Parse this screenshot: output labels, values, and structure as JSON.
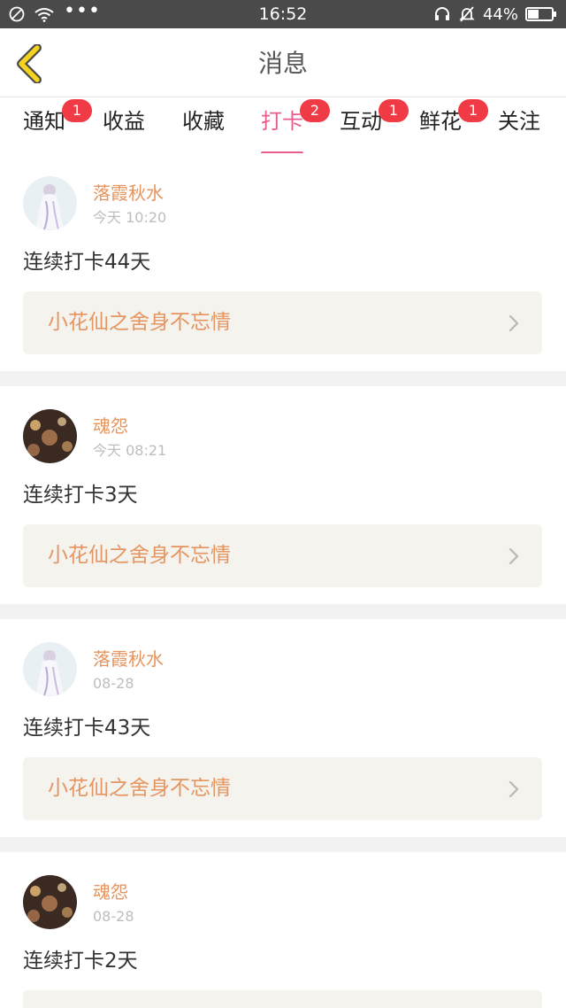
{
  "status_bar": {
    "time": "16:52",
    "battery": "44%",
    "icons": [
      "no-sim-icon",
      "wifi-icon",
      "more-dots-icon",
      "headset-icon",
      "mute-icon",
      "battery-icon"
    ]
  },
  "header": {
    "title": "消息",
    "back_icon": "back-chevron-icon",
    "accent_color": "#f5d21f"
  },
  "tabs": [
    {
      "label": "通知",
      "badge": "1"
    },
    {
      "label": "收益",
      "badge": ""
    },
    {
      "label": "收藏",
      "badge": ""
    },
    {
      "label": "打卡",
      "badge": "2",
      "active": true
    },
    {
      "label": "互动",
      "badge": "1"
    },
    {
      "label": "鲜花",
      "badge": "1"
    },
    {
      "label": "关注",
      "badge": ""
    }
  ],
  "colors": {
    "active_tab": "#e85d8f",
    "badge": "#f03a45",
    "username": "#e59560",
    "link_bg": "#f4f3ee"
  },
  "messages": [
    {
      "user": "落霞秋水",
      "time": "今天 10:20",
      "text": "连续打卡44天",
      "link": "小花仙之舍身不忘情",
      "avatar": "avatar-white-dress"
    },
    {
      "user": "魂怨",
      "time": "今天 08:21",
      "text": "连续打卡3天",
      "link": "小花仙之舍身不忘情",
      "avatar": "avatar-lights"
    },
    {
      "user": "落霞秋水",
      "time": "08-28",
      "text": "连续打卡43天",
      "link": "小花仙之舍身不忘情",
      "avatar": "avatar-white-dress"
    },
    {
      "user": "魂怨",
      "time": "08-28",
      "text": "连续打卡2天",
      "link": "",
      "avatar": "avatar-lights"
    }
  ]
}
